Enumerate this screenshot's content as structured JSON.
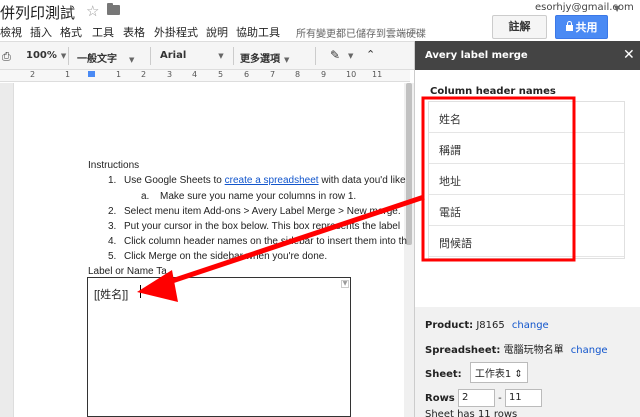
{
  "app": {
    "doc_title": "併列印測試",
    "account_email": "esorhjy@gmail.com",
    "comment_label": "註解",
    "share_label": "共用",
    "save_status": "所有變更都已儲存到雲端硬碟"
  },
  "menus": [
    "檢視",
    "插入",
    "格式",
    "工具",
    "表格",
    "外掛程式",
    "說明",
    "協助工具"
  ],
  "toolbar": {
    "zoom": "100%",
    "style": "一般文字",
    "font": "Arial",
    "more": "更多選項"
  },
  "ruler": [
    "2",
    "1",
    "1",
    "2",
    "3",
    "4",
    "5",
    "6",
    "7",
    "8",
    "9",
    "10",
    "11"
  ],
  "document": {
    "instructions_heading": "Instructions",
    "step1_prefix": "Use Google Sheets to",
    "step1_link": "create a spreadsheet",
    "step1_suffix": "with data you'd like",
    "step1a": "Make sure you name your columns in row 1.",
    "step2": "Select menu item Add-ons > Avery Label Merge > New merge.",
    "step3": "Put your cursor in the box below. This box represents the label",
    "step4": "Click column header names on the sidebar to insert them into th",
    "step5": "Click Merge on the sidebar when you're done.",
    "label_template_heading": "Label or Name Ta",
    "label_box_content": "[[姓名]]"
  },
  "sidebar": {
    "title": "Avery label merge",
    "column_header_label": "Column header names",
    "columns": [
      "姓名",
      "稱謂",
      "地址",
      "電話",
      "問候語"
    ],
    "product_label": "Product:",
    "product_value": "J8165",
    "change_label": "change",
    "spreadsheet_label": "Spreadsheet:",
    "spreadsheet_value": "電腦玩物名單",
    "sheet_label": "Sheet:",
    "sheet_value": "工作表1",
    "rows_label": "Rows",
    "rows_from": "2",
    "rows_dash": "-",
    "rows_to": "11",
    "sheet_count": "Sheet has 11 rows"
  },
  "colors": {
    "annotation": "#ff0000",
    "share_button": "#4a8af4",
    "sidebar_header": "#444444",
    "link": "#1155cc"
  }
}
